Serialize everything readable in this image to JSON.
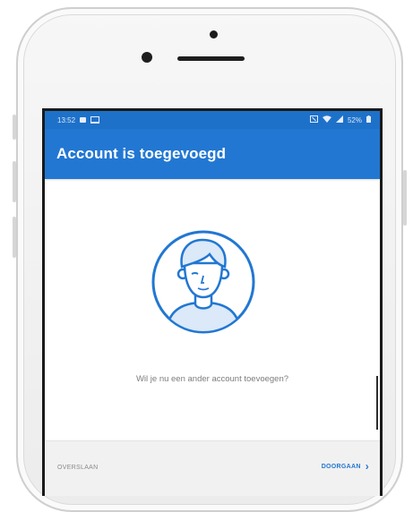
{
  "status_bar": {
    "time": "13:52",
    "battery": "52%"
  },
  "app_bar": {
    "title": "Account is toegevoegd"
  },
  "main": {
    "question": "Wil je nu een ander account toevoegen?"
  },
  "footer": {
    "skip_label": "OVERSLAAN",
    "continue_label": "DOORGAAN"
  },
  "icons": {
    "avatar": "person-avatar-icon",
    "next": "chevron-right-icon"
  },
  "colors": {
    "primary": "#2277d2",
    "status_bar": "#1e71c9",
    "footer_bg": "#f1f1f1"
  }
}
